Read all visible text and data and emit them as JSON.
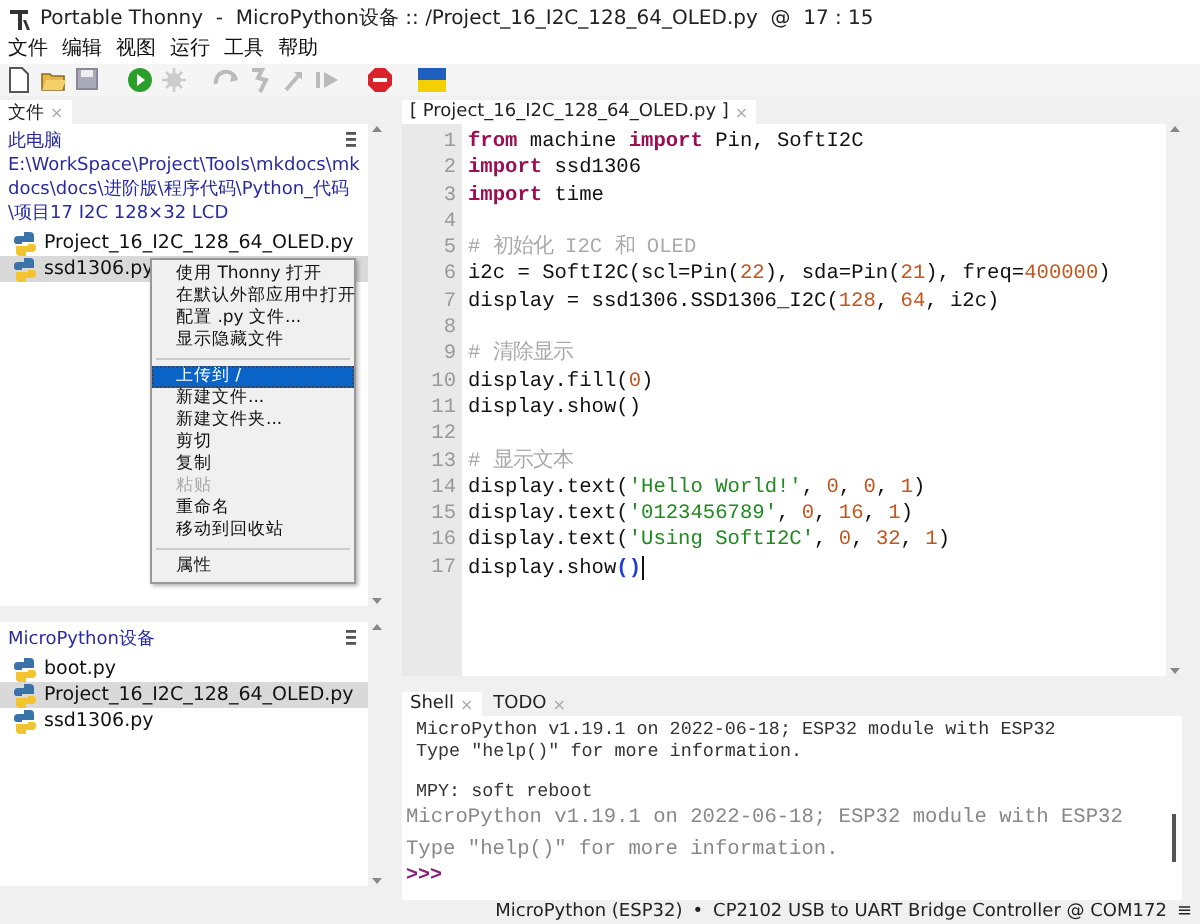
{
  "window": {
    "title": "Portable Thonny  -  MicroPython设备 :: /Project_16_I2C_128_64_OLED.py  @  17 : 15"
  },
  "menu": [
    "文件",
    "编辑",
    "视图",
    "运行",
    "工具",
    "帮助"
  ],
  "files_panel": {
    "tab": "文件",
    "close": "×",
    "location": "此电脑",
    "path": "E:\\WorkSpace\\Project\\Tools\\mkdocs\\mkdocs\\docs\\进阶版\\程序代码\\Python_代码\\项目17 I2C 128×32 LCD",
    "items": [
      {
        "name": "Project_16_I2C_128_64_OLED.py",
        "selected": false
      },
      {
        "name": "ssd1306.py",
        "selected": true
      }
    ]
  },
  "context_menu": [
    {
      "kind": "item",
      "label": "使用 Thonny 打开",
      "selected": false,
      "disabled": false
    },
    {
      "kind": "item",
      "label": "在默认外部应用中打开",
      "selected": false,
      "disabled": false
    },
    {
      "kind": "item",
      "label": "配置 .py 文件...",
      "selected": false,
      "disabled": false
    },
    {
      "kind": "item",
      "label": "显示隐藏文件",
      "selected": false,
      "disabled": false
    },
    {
      "kind": "separator"
    },
    {
      "kind": "item",
      "label": "上传到 /",
      "selected": true,
      "disabled": false
    },
    {
      "kind": "item",
      "label": "新建文件...",
      "selected": false,
      "disabled": false
    },
    {
      "kind": "item",
      "label": "新建文件夹...",
      "selected": false,
      "disabled": false
    },
    {
      "kind": "item",
      "label": "剪切",
      "selected": false,
      "disabled": false
    },
    {
      "kind": "item",
      "label": "复制",
      "selected": false,
      "disabled": false
    },
    {
      "kind": "item",
      "label": "粘贴",
      "selected": false,
      "disabled": true
    },
    {
      "kind": "item",
      "label": "重命名",
      "selected": false,
      "disabled": false
    },
    {
      "kind": "item",
      "label": "移动到回收站",
      "selected": false,
      "disabled": false
    },
    {
      "kind": "separator"
    },
    {
      "kind": "item",
      "label": "属性",
      "selected": false,
      "disabled": false
    }
  ],
  "device_panel": {
    "title": "MicroPython设备",
    "items": [
      {
        "name": "boot.py",
        "selected": false
      },
      {
        "name": "Project_16_I2C_128_64_OLED.py",
        "selected": true
      },
      {
        "name": "ssd1306.py",
        "selected": false
      }
    ]
  },
  "editor": {
    "tab": "[ Project_16_I2C_128_64_OLED.py ]",
    "close": "×",
    "lines": [
      {
        "number": "1",
        "tokens": [
          {
            "kind": "kw",
            "text": "from"
          },
          {
            "kind": "p",
            "text": " machine "
          },
          {
            "kind": "kw",
            "text": "import"
          },
          {
            "kind": "p",
            "text": " Pin, SoftI2C"
          }
        ]
      },
      {
        "number": "2",
        "tokens": [
          {
            "kind": "kw",
            "text": "import"
          },
          {
            "kind": "p",
            "text": " ssd1306"
          }
        ]
      },
      {
        "number": "3",
        "tokens": [
          {
            "kind": "kw",
            "text": "import"
          },
          {
            "kind": "p",
            "text": " time"
          }
        ]
      },
      {
        "number": "4"
      },
      {
        "number": "5",
        "tokens": [
          {
            "kind": "cm",
            "text": "# 初始化 I2C 和 OLED"
          }
        ]
      },
      {
        "number": "6",
        "tokens": [
          {
            "kind": "p",
            "text": "i2c = SoftI2C(scl=Pin("
          },
          {
            "kind": "num",
            "text": "22"
          },
          {
            "kind": "p",
            "text": "), sda=Pin("
          },
          {
            "kind": "num",
            "text": "21"
          },
          {
            "kind": "p",
            "text": "), freq="
          },
          {
            "kind": "num",
            "text": "400000"
          },
          {
            "kind": "p",
            "text": ")"
          }
        ]
      },
      {
        "number": "7",
        "tokens": [
          {
            "kind": "p",
            "text": "display = ssd1306.SSD1306_I2C("
          },
          {
            "kind": "num",
            "text": "128"
          },
          {
            "kind": "p",
            "text": ", "
          },
          {
            "kind": "num",
            "text": "64"
          },
          {
            "kind": "p",
            "text": ", i2c)"
          }
        ]
      },
      {
        "number": "8"
      },
      {
        "number": "9",
        "tokens": [
          {
            "kind": "cm",
            "text": "# 清除显示"
          }
        ]
      },
      {
        "number": "10",
        "tokens": [
          {
            "kind": "p",
            "text": "display.fill("
          },
          {
            "kind": "num",
            "text": "0"
          },
          {
            "kind": "p",
            "text": ")"
          }
        ]
      },
      {
        "number": "11",
        "tokens": [
          {
            "kind": "p",
            "text": "display.show()"
          }
        ]
      },
      {
        "number": "12"
      },
      {
        "number": "13",
        "tokens": [
          {
            "kind": "cm",
            "text": "# 显示文本"
          }
        ]
      },
      {
        "number": "14",
        "tokens": [
          {
            "kind": "p",
            "text": "display.text("
          },
          {
            "kind": "str",
            "text": "'Hello World!'"
          },
          {
            "kind": "p",
            "text": ", "
          },
          {
            "kind": "num",
            "text": "0"
          },
          {
            "kind": "p",
            "text": ", "
          },
          {
            "kind": "num",
            "text": "0"
          },
          {
            "kind": "p",
            "text": ", "
          },
          {
            "kind": "num",
            "text": "1"
          },
          {
            "kind": "p",
            "text": ")"
          }
        ]
      },
      {
        "number": "15",
        "tokens": [
          {
            "kind": "p",
            "text": "display.text("
          },
          {
            "kind": "str",
            "text": "'0123456789'"
          },
          {
            "kind": "p",
            "text": ", "
          },
          {
            "kind": "num",
            "text": "0"
          },
          {
            "kind": "p",
            "text": ", "
          },
          {
            "kind": "num",
            "text": "16"
          },
          {
            "kind": "p",
            "text": ", "
          },
          {
            "kind": "num",
            "text": "1"
          },
          {
            "kind": "p",
            "text": ")"
          }
        ]
      },
      {
        "number": "16",
        "tokens": [
          {
            "kind": "p",
            "text": "display.text("
          },
          {
            "kind": "str",
            "text": "'Using SoftI2C'"
          },
          {
            "kind": "p",
            "text": ", "
          },
          {
            "kind": "num",
            "text": "0"
          },
          {
            "kind": "p",
            "text": ", "
          },
          {
            "kind": "num",
            "text": "32"
          },
          {
            "kind": "p",
            "text": ", "
          },
          {
            "kind": "num",
            "text": "1"
          },
          {
            "kind": "p",
            "text": ")"
          }
        ]
      },
      {
        "number": "17",
        "tokens": [
          {
            "kind": "p",
            "text": "display.show"
          },
          {
            "kind": "match",
            "text": "()"
          },
          {
            "kind": "cursor"
          }
        ]
      }
    ]
  },
  "shell": {
    "tabs": [
      {
        "label": "Shell",
        "close": "×",
        "selected": true
      },
      {
        "label": "TODO",
        "close": "×",
        "selected": false
      }
    ],
    "lines": [
      {
        "kind": "old",
        "text": "MicroPython v1.19.1 on 2022-06-18; ESP32 module with ESP32"
      },
      {
        "kind": "old",
        "text": "Type \"help()\" for more information."
      },
      {
        "kind": "blank"
      },
      {
        "kind": "old",
        "text": "MPY: soft reboot"
      },
      {
        "kind": "new",
        "text": "MicroPython v1.19.1 on 2022-06-18; ESP32 module with ESP32"
      },
      {
        "kind": "new",
        "text": "Type \"help()\" for more information."
      },
      {
        "kind": "prompt",
        "text": ">>>"
      }
    ]
  },
  "status_bar": {
    "interpreter": "MicroPython (ESP32)",
    "separator": "•",
    "port": "CP2102 USB to UART Bridge Controller @ COM172",
    "menu": "≡"
  }
}
